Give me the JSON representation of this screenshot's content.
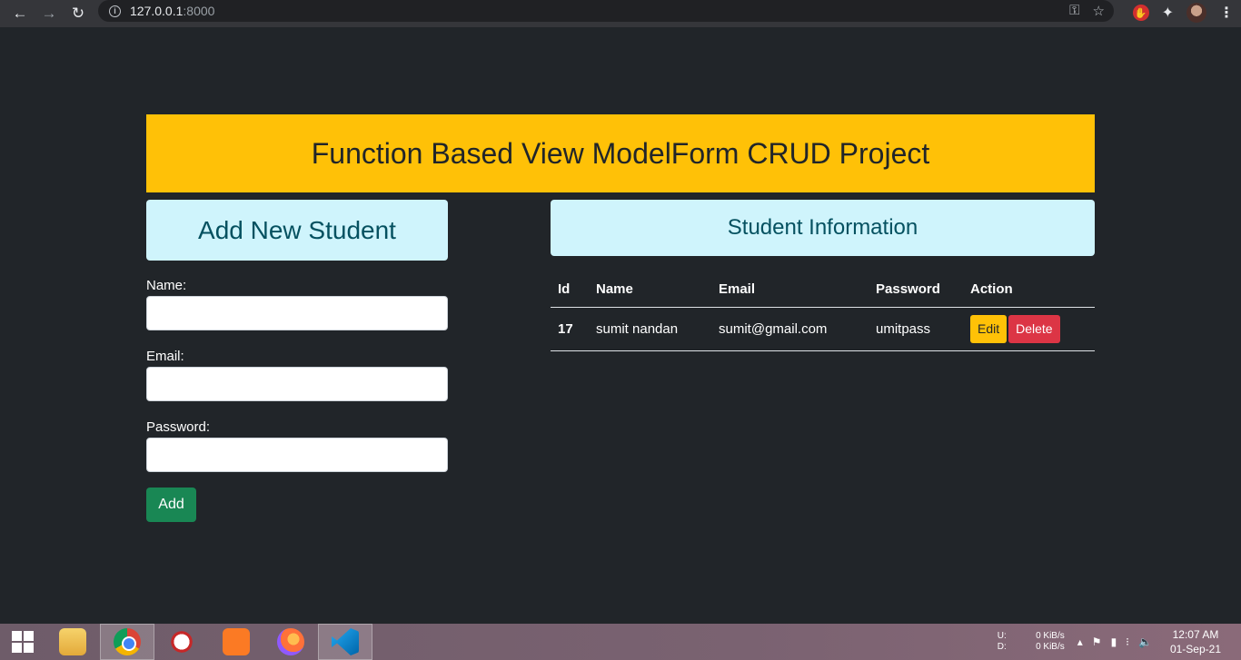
{
  "browser": {
    "url_host": "127.0.0.1",
    "url_port": ":8000"
  },
  "page": {
    "banner_title": "Function Based View ModelForm CRUD Project",
    "add_title": "Add New Student",
    "form": {
      "name_label": "Name:",
      "email_label": "Email:",
      "password_label": "Password:",
      "add_button": "Add"
    },
    "info_title": "Student Information",
    "table": {
      "headers": [
        "Id",
        "Name",
        "Email",
        "Password",
        "Action"
      ],
      "rows": [
        {
          "id": "17",
          "name": "sumit nandan",
          "email": "sumit@gmail.com",
          "password": "umitpass",
          "edit": "Edit",
          "delete": "Delete"
        }
      ]
    }
  },
  "taskbar": {
    "net_upload_label": "U:",
    "net_upload_value": "0 KiB/s",
    "net_download_label": "D:",
    "net_download_value": "0 KiB/s",
    "time": "12:07 AM",
    "date": "01-Sep-21"
  },
  "colors": {
    "page_bg": "#212529",
    "banner": "#ffc107",
    "info_bg": "#cff4fc",
    "info_text": "#055160",
    "add_button": "#198754",
    "edit_button": "#ffc107",
    "delete_button": "#dc3545"
  }
}
